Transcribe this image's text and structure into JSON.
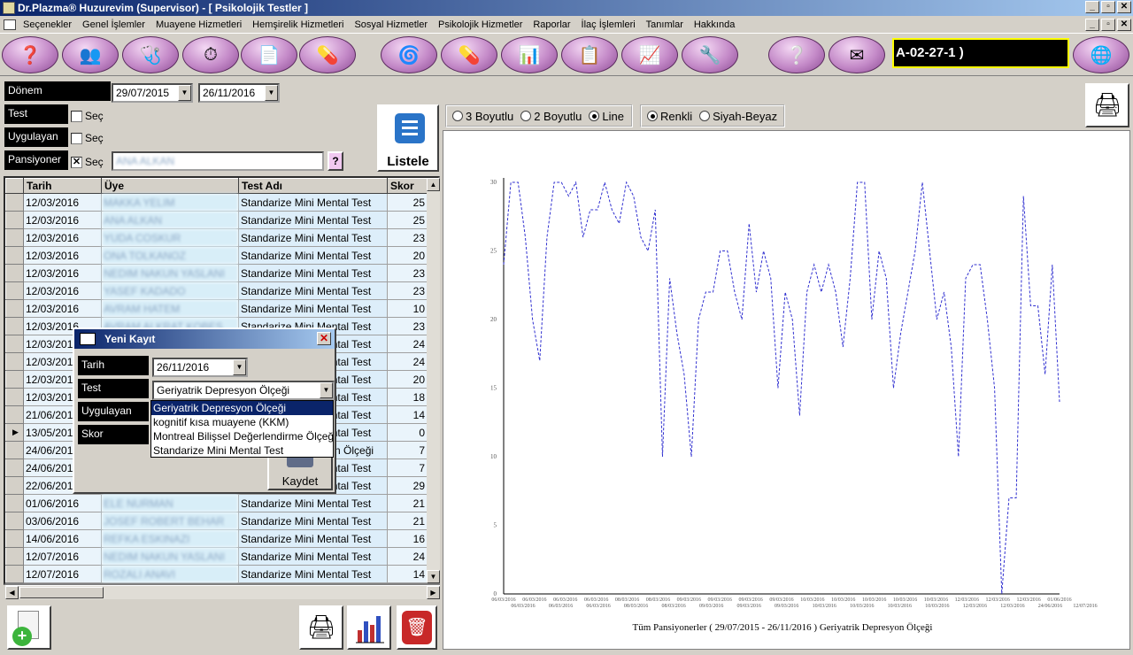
{
  "window": {
    "title": "Dr.Plazma® Huzurevim (Supervisor) - [ Psikolojik Testler ]"
  },
  "menu": [
    "Seçenekler",
    "Genel İşlemler",
    "Muayene Hizmetleri",
    "Hemşirelik Hizmetleri",
    "Sosyal Hizmetler",
    "Psikolojik Hizmetler",
    "Raporlar",
    "İlaç İşlemleri",
    "Tanımlar",
    "Hakkında"
  ],
  "toolbar": {
    "id_display": "A-02-27-1 )"
  },
  "filters": {
    "donem_label": "Dönem",
    "date_from": "29/07/2015",
    "date_to": "26/11/2016",
    "test_label": "Test",
    "uygulayan_label": "Uygulayan",
    "pansiyoner_label": "Pansiyoner",
    "sec_label": "Seç",
    "pansiyoner_value": "ANA ALKAN",
    "help_label": "?",
    "listele_label": "Listele"
  },
  "grid": {
    "headers": [
      "Tarih",
      "Üye",
      "Test Adı",
      "Skor"
    ],
    "rows": [
      {
        "date": "12/03/2016",
        "user": "MAKKA YELIM",
        "test": "Standarize Mini Mental Test",
        "score": "25"
      },
      {
        "date": "12/03/2016",
        "user": "ANA ALKAN",
        "test": "Standarize Mini Mental Test",
        "score": "25"
      },
      {
        "date": "12/03/2016",
        "user": "YUDA COSKUR",
        "test": "Standarize Mini Mental Test",
        "score": "23"
      },
      {
        "date": "12/03/2016",
        "user": "ONA TOLKANOZ",
        "test": "Standarize Mini Mental Test",
        "score": "20"
      },
      {
        "date": "12/03/2016",
        "user": "NEDIM NAKUN YASLANI",
        "test": "Standarize Mini Mental Test",
        "score": "23"
      },
      {
        "date": "12/03/2016",
        "user": "YASEF KADADO",
        "test": "Standarize Mini Mental Test",
        "score": "23"
      },
      {
        "date": "12/03/2016",
        "user": "AVRAM HATEM",
        "test": "Standarize Mini Mental Test",
        "score": "10"
      },
      {
        "date": "12/03/2016",
        "user": "AVRAM ALKRAT KOBES",
        "test": "Standarize Mini Mental Test",
        "score": "23"
      },
      {
        "date": "12/03/2016",
        "user": "",
        "test": "Standarize Mini Mental Test",
        "score": "24"
      },
      {
        "date": "12/03/2016",
        "user": "",
        "test": "Standarize Mini Mental Test",
        "score": "24"
      },
      {
        "date": "12/03/2016",
        "user": "",
        "test": "Standarize Mini Mental Test",
        "score": "20"
      },
      {
        "date": "12/03/2016",
        "user": "",
        "test": "Standarize Mini Mental Test",
        "score": "18"
      },
      {
        "date": "21/06/2016",
        "user": "",
        "test": "Standarize Mini Mental Test",
        "score": "14"
      },
      {
        "date": "13/05/2016",
        "user": "",
        "test": "Standarize Mini Mental Test",
        "score": "0"
      },
      {
        "date": "24/06/2016",
        "user": "",
        "test": "Geriyatrik Depresyon Ölçeği",
        "score": "7"
      },
      {
        "date": "24/06/2016",
        "user": "",
        "test": "Standarize Mini Mental Test",
        "score": "7"
      },
      {
        "date": "22/06/2016",
        "user": "",
        "test": "Standarize Mini Mental Test",
        "score": "29"
      },
      {
        "date": "01/06/2016",
        "user": "ELE NURMAN",
        "test": "Standarize Mini Mental Test",
        "score": "21"
      },
      {
        "date": "03/06/2016",
        "user": "JOSEF ROBERT BEHAR",
        "test": "Standarize Mini Mental Test",
        "score": "21"
      },
      {
        "date": "14/06/2016",
        "user": "REFKA ESKINAZI",
        "test": "Standarize Mini Mental Test",
        "score": "16"
      },
      {
        "date": "12/07/2016",
        "user": "NEDIM NAKUN YASLANI",
        "test": "Standarize Mini Mental Test",
        "score": "24"
      },
      {
        "date": "12/07/2016",
        "user": "ROZALI ANAVI",
        "test": "Standarize Mini Mental Test",
        "score": "14"
      }
    ]
  },
  "chart_options": {
    "view": [
      "3 Boyutlu",
      "2 Boyutlu",
      "Line"
    ],
    "view_selected": "Line",
    "color": [
      "Renkli",
      "Siyah-Beyaz"
    ],
    "color_selected": "Renkli"
  },
  "chart_data": {
    "type": "line",
    "title": "Tüm Pansiyonerler ( 29/07/2015 - 26/11/2016 ) Geriyatrik Depresyon Ölçeği",
    "ylim": [
      0,
      30
    ],
    "yticks": [
      0,
      5,
      10,
      15,
      20,
      25,
      30
    ],
    "xticks_top": [
      "06/03/2016",
      "06/03/2016",
      "06/03/2016",
      "06/03/2016",
      "08/03/2016",
      "08/03/2016",
      "09/03/2016",
      "09/03/2016",
      "09/03/2016",
      "09/03/2016",
      "10/03/2016",
      "10/03/2016",
      "10/03/2016",
      "10/03/2016",
      "10/03/2016",
      "12/03/2016",
      "12/03/2016",
      "12/03/2016",
      "01/06/2016"
    ],
    "xticks_bottom": [
      "06/03/2016",
      "06/03/2016",
      "06/03/2016",
      "08/03/2016",
      "08/03/2016",
      "09/03/2016",
      "09/03/2016",
      "09/03/2016",
      "10/03/2016",
      "10/03/2016",
      "10/03/2016",
      "10/03/2016",
      "12/03/2016",
      "12/03/2016",
      "24/06/2016",
      "12/07/2016"
    ],
    "series_color": "#3030d0",
    "values": [
      24,
      30,
      30,
      26,
      20,
      17,
      26,
      30,
      30,
      29,
      30,
      26,
      28,
      28,
      30,
      28,
      27,
      30,
      29,
      26,
      25,
      28,
      10,
      23,
      19,
      16,
      10,
      20,
      22,
      22,
      25,
      25,
      22,
      20,
      27,
      22,
      25,
      23,
      15,
      22,
      20,
      13,
      22,
      24,
      22,
      24,
      22,
      18,
      23,
      30,
      30,
      20,
      25,
      23,
      15,
      19,
      22,
      25,
      30,
      25,
      20,
      22,
      18,
      10,
      23,
      24,
      24,
      20,
      15,
      0,
      7,
      7,
      29,
      21,
      21,
      16,
      24,
      14
    ]
  },
  "dialog": {
    "title": "Yeni Kayıt",
    "tarih_label": "Tarih",
    "tarih_value": "26/11/2016",
    "test_label": "Test",
    "test_value": "Geriyatrik Depresyon Ölçeği",
    "uygulayan_label": "Uygulayan",
    "skor_label": "Skor",
    "kaydet_label": "Kaydet",
    "options": [
      "Geriyatrik Depresyon Ölçeği",
      "kognitif kısa muayene (KKM)",
      "Montreal Bilişsel Değerlendirme Ölçeği",
      "Standarize Mini Mental Test"
    ],
    "selected_option": "Geriyatrik Depresyon Ölçeği"
  }
}
